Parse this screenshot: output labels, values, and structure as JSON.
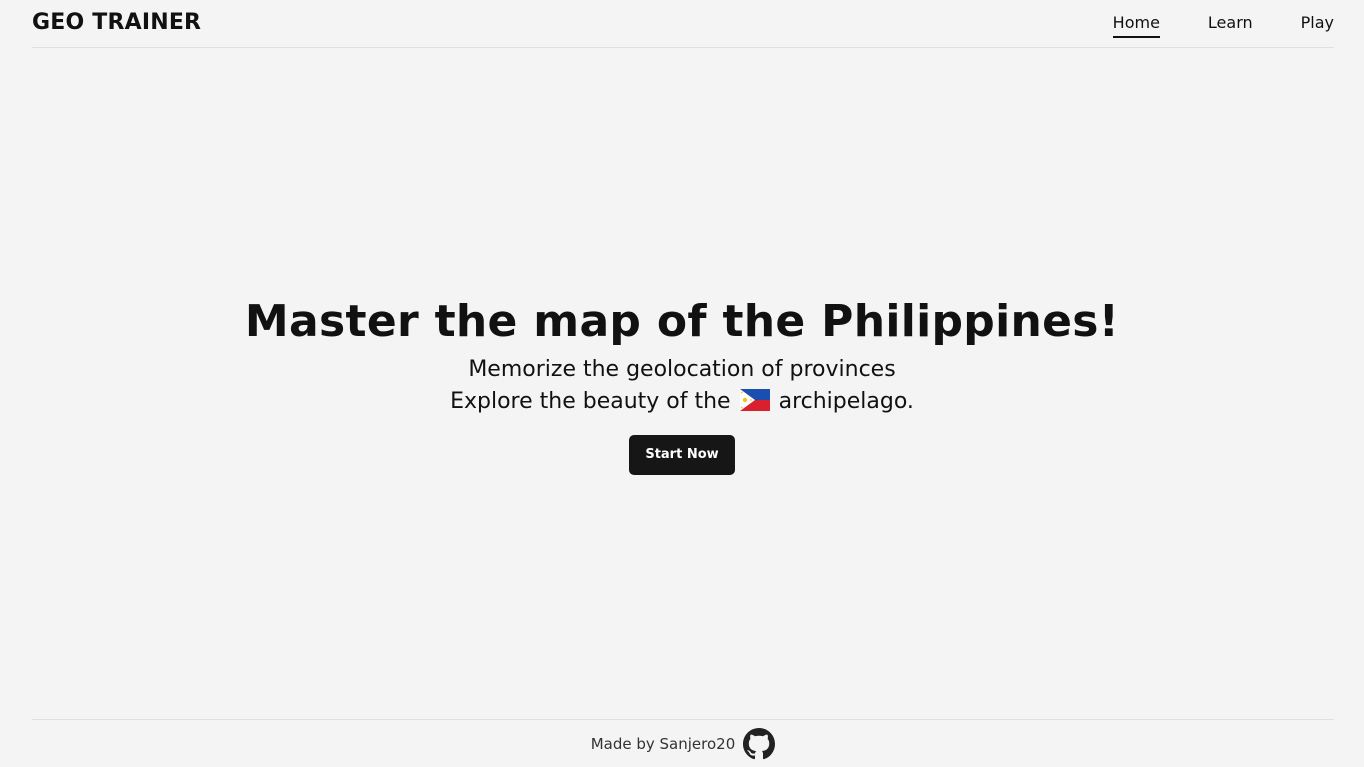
{
  "header": {
    "brand": "GEO TRAINER",
    "nav": [
      {
        "label": "Home",
        "active": true
      },
      {
        "label": "Learn",
        "active": false
      },
      {
        "label": "Play",
        "active": false
      }
    ]
  },
  "hero": {
    "title": "Master the map of the Philippines!",
    "line1": "Memorize the geolocation of provinces",
    "line2_before": "Explore the beauty of the",
    "line2_flag_icon": "philippines-flag-icon",
    "line2_after": "archipelago.",
    "cta_label": "Start Now"
  },
  "footer": {
    "text": "Made by Sanjero20",
    "icon": "github-icon"
  },
  "colors": {
    "background": "#f4f4f4",
    "text": "#111111",
    "button": "#161616",
    "button_text": "#ffffff",
    "divider": "#e0e0e0"
  }
}
